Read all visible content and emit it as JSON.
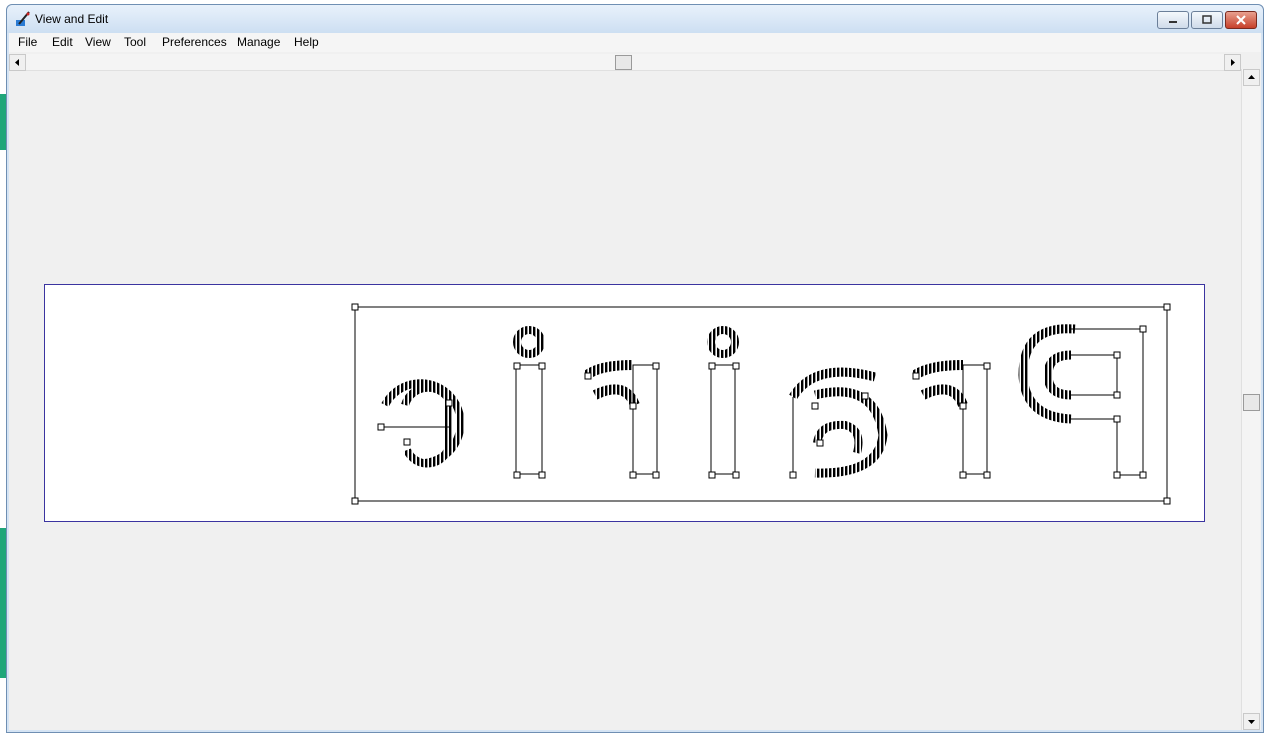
{
  "window": {
    "title": "View and Edit"
  },
  "menu": [
    {
      "label": "File"
    },
    {
      "label": "Edit"
    },
    {
      "label": "View"
    },
    {
      "label": "Tool"
    },
    {
      "label": "Preferences"
    },
    {
      "label": "Manage"
    },
    {
      "label": "Help"
    }
  ],
  "icons": {
    "app": "embroidery-needle-icon",
    "minimize": "minimize-icon",
    "maximize": "restore-icon",
    "close": "close-icon",
    "scroll_left": "arrow-left-icon",
    "scroll_right": "arrow-right-icon",
    "scroll_up": "arrow-up-icon",
    "scroll_down": "arrow-down-icon"
  },
  "colors": {
    "canvas_border": "#3b34a0",
    "stitch": "#000000",
    "client_bg": "#f0f0f0"
  },
  "design": {
    "glyph_count": 7
  }
}
